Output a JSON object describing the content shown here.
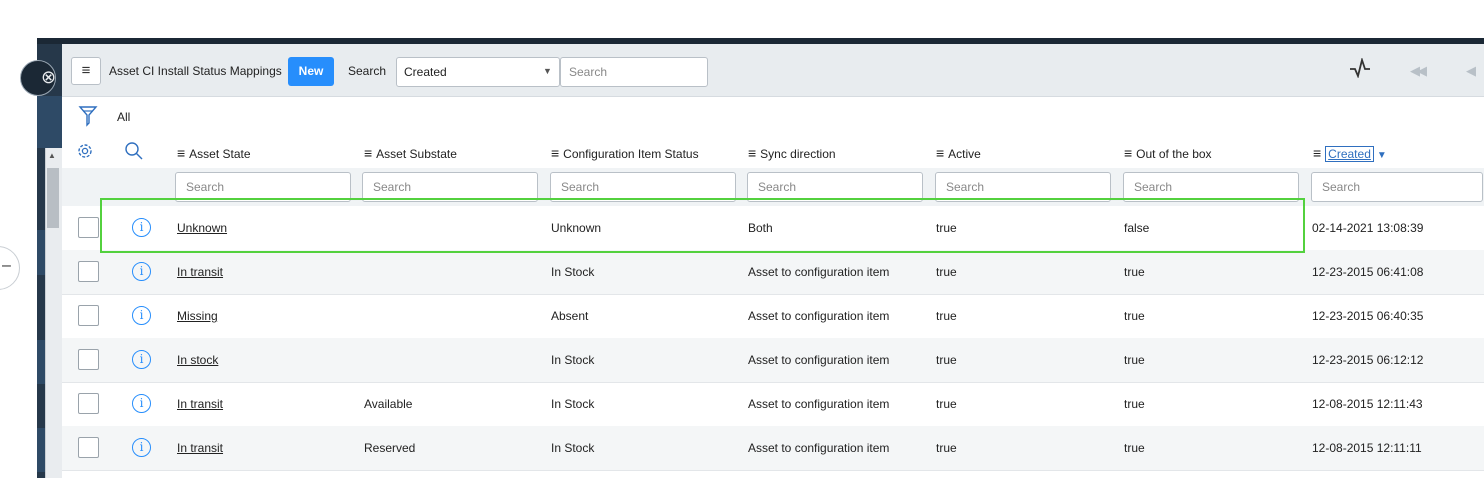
{
  "header": {
    "menu_glyph": "≡",
    "list_title": "Asset CI Install Status Mappings",
    "new_label": "New",
    "search_label": "Search",
    "search_field_selected": "Created",
    "search_placeholder": "Search"
  },
  "breadcrumb": {
    "all_label": "All"
  },
  "columns": [
    {
      "label": "Asset State"
    },
    {
      "label": "Asset Substate"
    },
    {
      "label": "Configuration Item Status"
    },
    {
      "label": "Sync direction"
    },
    {
      "label": "Active"
    },
    {
      "label": "Out of the box"
    },
    {
      "label": "Created",
      "sorted": "descending"
    }
  ],
  "column_search_placeholder": "Search",
  "rows": [
    {
      "asset_state": "Unknown",
      "asset_substate": "",
      "ci_status": "Unknown",
      "sync_direction": "Both",
      "active": "true",
      "out_of_box": "false",
      "created": "02-14-2021 13:08:39",
      "highlighted": true
    },
    {
      "asset_state": "In transit",
      "asset_substate": "",
      "ci_status": "In Stock",
      "sync_direction": "Asset to configuration item",
      "active": "true",
      "out_of_box": "true",
      "created": "12-23-2015 06:41:08"
    },
    {
      "asset_state": "Missing",
      "asset_substate": "",
      "ci_status": "Absent",
      "sync_direction": "Asset to configuration item",
      "active": "true",
      "out_of_box": "true",
      "created": "12-23-2015 06:40:35"
    },
    {
      "asset_state": "In stock",
      "asset_substate": "",
      "ci_status": "In Stock",
      "sync_direction": "Asset to configuration item",
      "active": "true",
      "out_of_box": "true",
      "created": "12-23-2015 06:12:12"
    },
    {
      "asset_state": "In transit",
      "asset_substate": "Available",
      "ci_status": "In Stock",
      "sync_direction": "Asset to configuration item",
      "active": "true",
      "out_of_box": "true",
      "created": "12-08-2015 12:11:43"
    },
    {
      "asset_state": "In transit",
      "asset_substate": "Reserved",
      "ci_status": "In Stock",
      "sync_direction": "Asset to configuration item",
      "active": "true",
      "out_of_box": "true",
      "created": "12-08-2015 12:11:11"
    }
  ],
  "colors": {
    "accent": "#278efc",
    "highlight": "#53d13e",
    "nav_dark": "#1b2835",
    "header_bg": "#e8ecef"
  },
  "icons": [
    "menu-icon",
    "filter-icon",
    "gear-icon",
    "search-icon",
    "info-icon",
    "activity-icon",
    "first-page-icon",
    "previous-page-icon",
    "close-icon",
    "collapse-icon"
  ]
}
